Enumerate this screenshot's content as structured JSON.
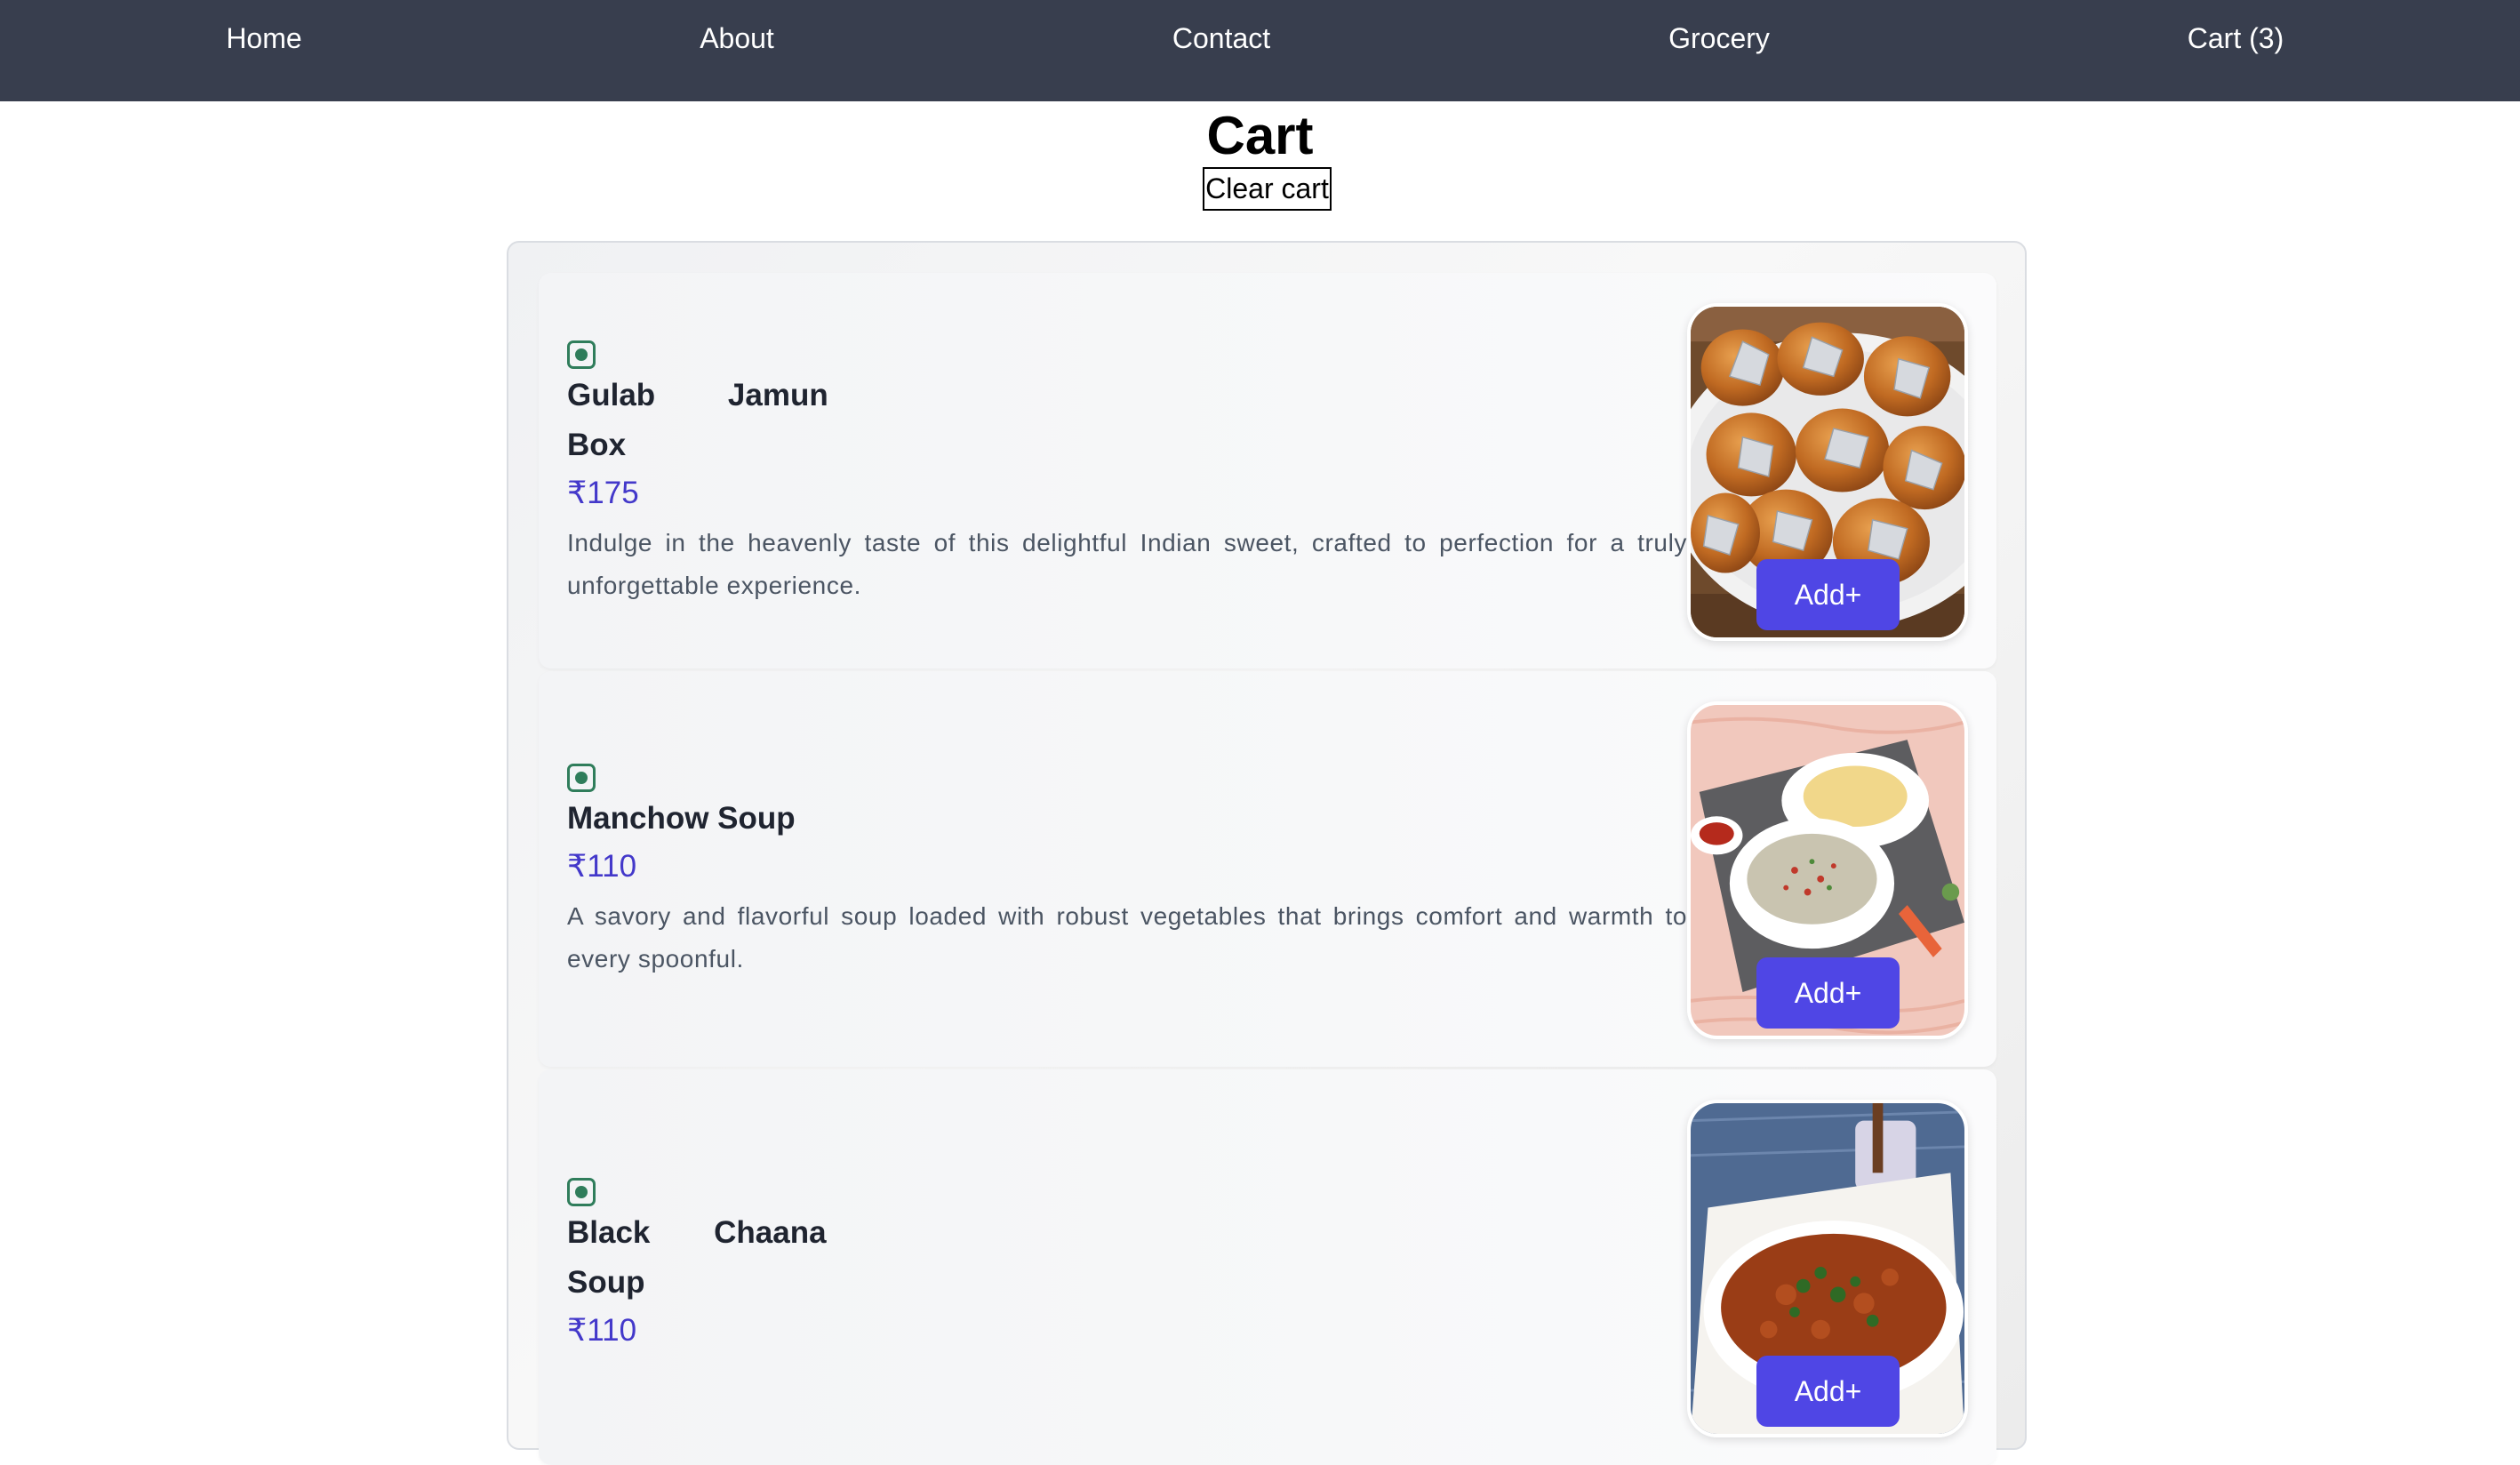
{
  "nav": {
    "home": "Home",
    "about": "About",
    "contact": "Contact",
    "grocery": "Grocery",
    "cart": "Cart (3)"
  },
  "page": {
    "title": "Cart",
    "clear_cart_label": "Clear cart"
  },
  "colors": {
    "nav_bg": "#383e4e",
    "accent": "#4f46e5",
    "price": "#4338ca",
    "veg_indicator": "#2f7d5b"
  },
  "items": [
    {
      "name_words": [
        "Gulab",
        "Jamun",
        "Box"
      ],
      "price": "₹175",
      "description": "Indulge in the heavenly taste of this delightful Indian sweet, crafted to perfection for a truly unforgettable experience.",
      "add_label": "Add+",
      "image": "gulab-jamun-photo",
      "veg_icon": "veg-indicator-icon"
    },
    {
      "name": "Manchow Soup",
      "price": "₹110",
      "description": "A savory and flavorful soup loaded with robust vegetables that brings comfort and warmth to every spoonful.",
      "add_label": "Add+",
      "image": "manchow-soup-photo",
      "veg_icon": "veg-indicator-icon"
    },
    {
      "name_words": [
        "Black",
        "Chaana",
        "Soup"
      ],
      "price": "₹110",
      "description": "",
      "add_label": "Add+",
      "image": "black-chaana-soup-photo",
      "veg_icon": "veg-indicator-icon"
    }
  ]
}
